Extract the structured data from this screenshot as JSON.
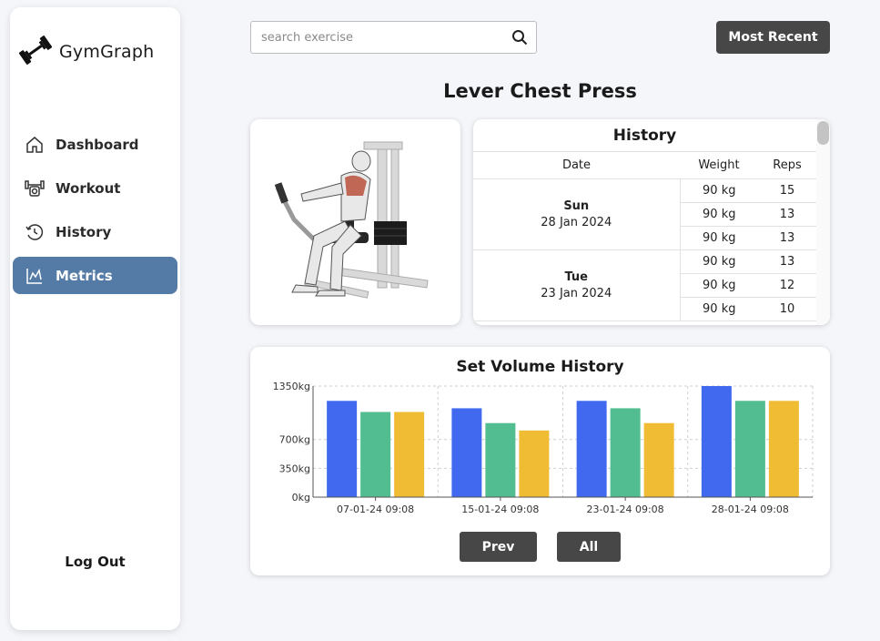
{
  "app": {
    "name": "GymGraph"
  },
  "sidebar": {
    "items": [
      {
        "label": "Dashboard",
        "icon": "home-icon"
      },
      {
        "label": "Workout",
        "icon": "workout-icon"
      },
      {
        "label": "History",
        "icon": "history-icon"
      },
      {
        "label": "Metrics",
        "icon": "metrics-icon",
        "active": true
      }
    ],
    "logout": "Log Out"
  },
  "search": {
    "placeholder": "search exercise",
    "value": ""
  },
  "sort_button": "Most Recent",
  "exercise": {
    "title": "Lever Chest Press"
  },
  "history": {
    "title": "History",
    "columns": [
      "Date",
      "Weight",
      "Reps"
    ],
    "sessions": [
      {
        "day": "Sun",
        "date": "28 Jan 2024",
        "sets": [
          {
            "weight": "90 kg",
            "reps": "15"
          },
          {
            "weight": "90 kg",
            "reps": "13"
          },
          {
            "weight": "90 kg",
            "reps": "13"
          }
        ]
      },
      {
        "day": "Tue",
        "date": "23 Jan 2024",
        "sets": [
          {
            "weight": "90 kg",
            "reps": "13"
          },
          {
            "weight": "90 kg",
            "reps": "12"
          },
          {
            "weight": "90 kg",
            "reps": "10"
          }
        ]
      }
    ]
  },
  "chart": {
    "title": "Set Volume History",
    "prev_label": "Prev",
    "all_label": "All"
  },
  "chart_data": {
    "type": "bar",
    "title": "Set Volume History",
    "categories": [
      "07-01-24 09:08",
      "15-01-24 09:08",
      "23-01-24 09:08",
      "28-01-24 09:08"
    ],
    "series": [
      {
        "values": [
          1170,
          1080,
          1170,
          1350
        ],
        "color": "#4169f0"
      },
      {
        "values": [
          1035,
          900,
          1080,
          1170
        ],
        "color": "#52bd91"
      },
      {
        "values": [
          1035,
          810,
          900,
          1170
        ],
        "color": "#f0bc34"
      }
    ],
    "yticks": [
      0,
      350,
      700,
      1350
    ],
    "ytick_labels": [
      "0kg",
      "350kg",
      "700kg",
      "1350kg"
    ],
    "ylim": [
      0,
      1350
    ],
    "grid": true
  }
}
